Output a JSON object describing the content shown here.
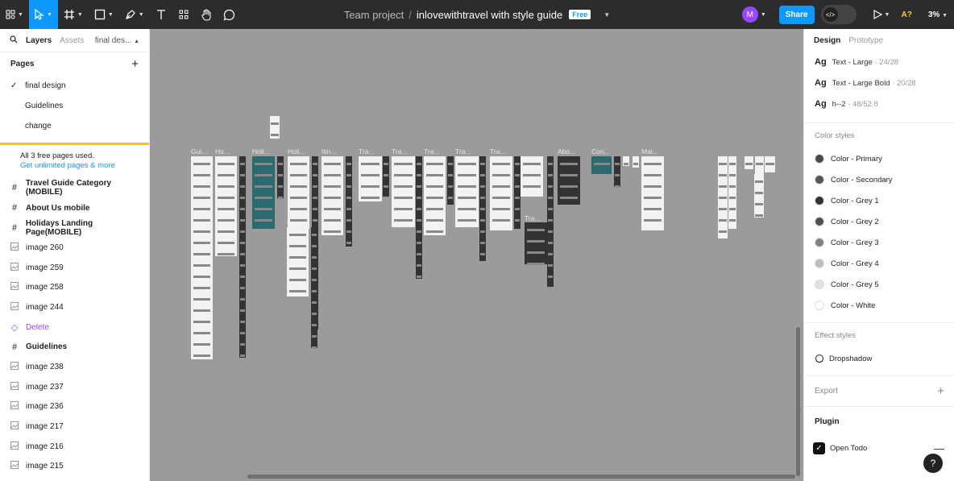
{
  "topbar": {
    "tools": [
      {
        "name": "main-menu",
        "icon": "figma-grid-icon"
      },
      {
        "name": "move-tool",
        "icon": "cursor-icon",
        "active": true
      },
      {
        "name": "frame-tool",
        "icon": "frame-hash-icon"
      },
      {
        "name": "shape-tool",
        "icon": "rectangle-icon"
      },
      {
        "name": "pen-tool",
        "icon": "pen-icon"
      },
      {
        "name": "text-tool",
        "icon": "text-t-icon"
      },
      {
        "name": "resources-tool",
        "icon": "components-icon"
      },
      {
        "name": "hand-tool",
        "icon": "hand-icon"
      },
      {
        "name": "comment-tool",
        "icon": "comment-bubble-icon"
      }
    ],
    "team": "Team project",
    "separator": "/",
    "file": "inlovewithtravel with style guide",
    "badge": "Free",
    "avatar": "M",
    "share": "Share",
    "dev_icon": "</>",
    "plugin_badge": "A?",
    "zoom": "3%"
  },
  "left": {
    "tabs": {
      "layers": "Layers",
      "assets": "Assets",
      "page": "final des..."
    },
    "pages_title": "Pages",
    "pages": [
      "final design",
      "Guidelines",
      "change"
    ],
    "promo": {
      "text": "All 3 free pages used.",
      "link": "Get unlimited pages & more"
    },
    "layers": [
      {
        "icon": "frame",
        "label": "Travel Guide Category (MOBILE)"
      },
      {
        "icon": "frame",
        "label": "About Us mobile"
      },
      {
        "icon": "frame",
        "label": "Holidays Landing Page(MOBILE)"
      },
      {
        "icon": "image",
        "label": "image 260"
      },
      {
        "icon": "image",
        "label": "image 259"
      },
      {
        "icon": "image",
        "label": "image 258"
      },
      {
        "icon": "image",
        "label": "image 244"
      },
      {
        "icon": "component",
        "label": "Delete"
      },
      {
        "icon": "frame",
        "label": "Guidelines"
      },
      {
        "icon": "image",
        "label": "image 238"
      },
      {
        "icon": "image",
        "label": "image 237"
      },
      {
        "icon": "image",
        "label": "image 236"
      },
      {
        "icon": "image",
        "label": "image 217"
      },
      {
        "icon": "image",
        "label": "image 216"
      },
      {
        "icon": "image",
        "label": "image 215"
      },
      {
        "icon": "image",
        "label": "image 57"
      }
    ]
  },
  "right": {
    "tabs": {
      "design": "Design",
      "prototype": "Prototype"
    },
    "text_styles": [
      {
        "ag": "Ag",
        "name": "Text - Large",
        "meta": " · 24/28",
        "bold": false
      },
      {
        "ag": "Ag",
        "name": "Text - Large Bold",
        "meta": " · 20/28",
        "bold": true
      },
      {
        "ag": "Ag",
        "name": "h--2",
        "meta": " · 48/52.8",
        "bold": false
      }
    ],
    "color_styles_title": "Color styles",
    "color_styles": [
      {
        "name": "Color - Primary",
        "hex": "#4a4a4a"
      },
      {
        "name": "Color - Secondary",
        "hex": "#555555"
      },
      {
        "name": "Color - Grey 1",
        "hex": "#333333"
      },
      {
        "name": "Color - Grey 2",
        "hex": "#4f4f4f"
      },
      {
        "name": "Color - Grey 3",
        "hex": "#828282"
      },
      {
        "name": "Color - Grey 4",
        "hex": "#bdbdbd"
      },
      {
        "name": "Color - Grey 5",
        "hex": "#e0e0e0"
      },
      {
        "name": "Color - White",
        "hex": "#ffffff"
      }
    ],
    "effect_styles_title": "Effect styles",
    "effect": "Dropshadow",
    "export": "Export",
    "plugin_title": "Plugin",
    "plugin": "Open Todo",
    "help": "?"
  },
  "canvas": {
    "labels": [
      "Gui...",
      "Ho...",
      "Holi...",
      "Holi...",
      "Itin...",
      "Tra...",
      "Tra...",
      "Tra...",
      "Tra...",
      "Tra...",
      "Abo...",
      "Con...",
      "Mai...",
      "Holi...",
      "Tra..."
    ]
  },
  "colors": {
    "accent": "#0d99ff",
    "toolbar": "#2c2c2c",
    "canvas": "#9b9b9b",
    "component": "#9747ff"
  }
}
